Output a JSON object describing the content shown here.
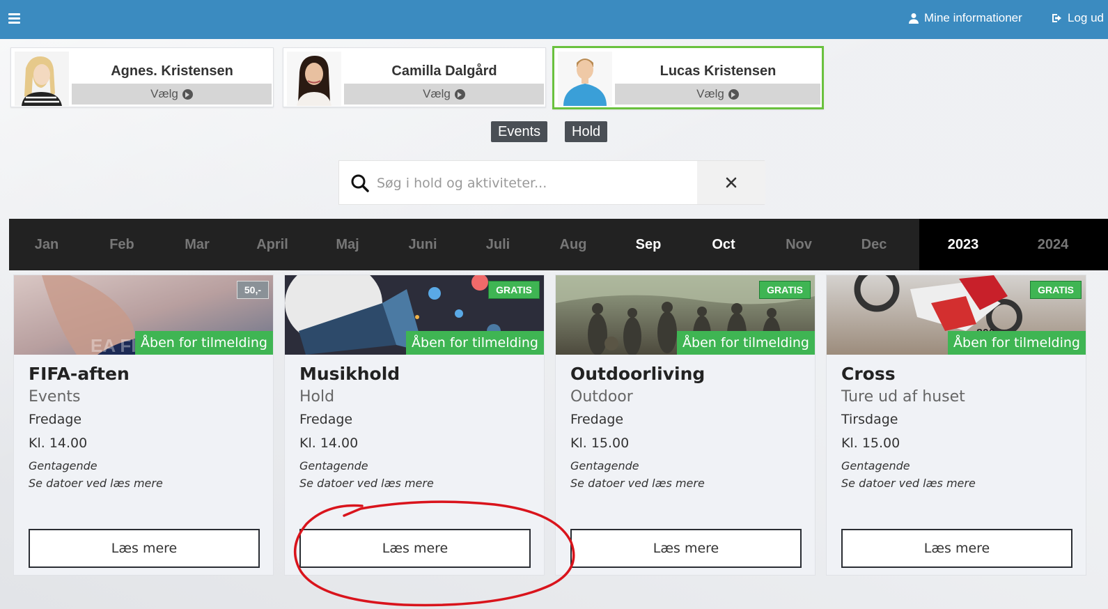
{
  "topbar": {
    "menu_icon": "hamburger-menu-icon",
    "account_label": "Mine informationer",
    "logout_label": "Log ud"
  },
  "profiles": [
    {
      "name": "Agnes. Kristensen",
      "select_label": "Vælg",
      "selected": false
    },
    {
      "name": "Camilla Dalgård",
      "select_label": "Vælg",
      "selected": false
    },
    {
      "name": "Lucas Kristensen",
      "select_label": "Vælg",
      "selected": true
    }
  ],
  "filters": [
    "Events",
    "Hold"
  ],
  "search": {
    "placeholder": "Søg i hold og aktiviteter...",
    "value": ""
  },
  "months": [
    {
      "label": "Jan",
      "active": false
    },
    {
      "label": "Feb",
      "active": false
    },
    {
      "label": "Mar",
      "active": false
    },
    {
      "label": "April",
      "active": false
    },
    {
      "label": "Maj",
      "active": false
    },
    {
      "label": "Juni",
      "active": false
    },
    {
      "label": "Juli",
      "active": false
    },
    {
      "label": "Aug",
      "active": false
    },
    {
      "label": "Sep",
      "active": true
    },
    {
      "label": "Oct",
      "active": true
    },
    {
      "label": "Nov",
      "active": false
    },
    {
      "label": "Dec",
      "active": false
    }
  ],
  "years": [
    {
      "label": "2023",
      "active": true
    },
    {
      "label": "2024",
      "active": false
    }
  ],
  "cards": [
    {
      "title": "FIFA-aften",
      "category": "Events",
      "day": "Fredage",
      "time": "Kl. 14.00",
      "recurring": "Gentagende",
      "dates_note": "Se datoer ved læs mere",
      "price": "50,-",
      "status": "Åben for tilmelding",
      "button": "Læs mere"
    },
    {
      "title": "Musikhold",
      "category": "Hold",
      "day": "Fredage",
      "time": "Kl. 14.00",
      "recurring": "Gentagende",
      "dates_note": "Se datoer ved læs mere",
      "price": "GRATIS",
      "status": "Åben for tilmelding",
      "button": "Læs mere"
    },
    {
      "title": "Outdoorliving",
      "category": "Outdoor",
      "day": "Fredage",
      "time": "Kl. 15.00",
      "recurring": "Gentagende",
      "dates_note": "Se datoer ved læs mere",
      "price": "GRATIS",
      "status": "Åben for tilmelding",
      "button": "Læs mere"
    },
    {
      "title": "Cross",
      "category": "Ture ud af huset",
      "day": "Tirsdage",
      "time": "Kl. 15.00",
      "recurring": "Gentagende",
      "dates_note": "Se datoer ved læs mere",
      "price": "GRATIS",
      "status": "Åben for tilmelding",
      "button": "Læs mere"
    }
  ],
  "colors": {
    "topbar": "#3b8bc0",
    "status_green": "#3fb553",
    "selected_border": "#6ac13e",
    "month_bar": "#222222",
    "annotation_red": "#d9141c"
  }
}
